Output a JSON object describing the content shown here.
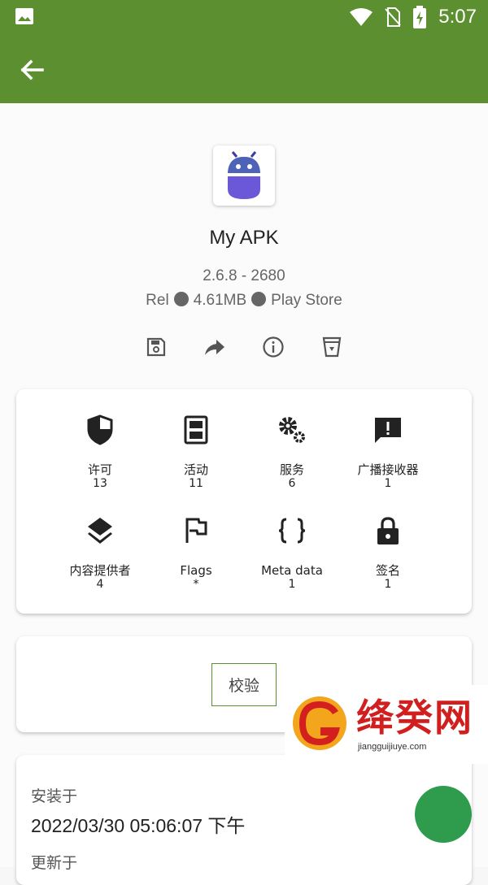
{
  "status_bar": {
    "time": "5:07",
    "icons": [
      "image-icon",
      "wifi-icon",
      "no-sim-icon",
      "battery-charging-icon"
    ]
  },
  "toolbar": {
    "back_icon": "back-arrow-icon"
  },
  "app": {
    "name": "My APK",
    "version": "2.6.8 - 2680",
    "meta": {
      "type": "Rel",
      "size": "4.61MB",
      "source": "Play Store"
    }
  },
  "actions": [
    "save-icon",
    "share-icon",
    "info-icon",
    "uninstall-icon"
  ],
  "components": [
    {
      "label": "许可",
      "count": "13",
      "icon": "shield-icon"
    },
    {
      "label": "活动",
      "count": "11",
      "icon": "activity-icon"
    },
    {
      "label": "服务",
      "count": "6",
      "icon": "gears-icon"
    },
    {
      "label": "广播接收器",
      "count": "1",
      "icon": "message-alert-icon"
    },
    {
      "label": "内容提供者",
      "count": "4",
      "icon": "layers-icon"
    },
    {
      "label": "Flags",
      "count": "*",
      "icon": "flag-icon"
    },
    {
      "label": "Meta data",
      "count": "1",
      "icon": "braces-icon"
    },
    {
      "label": "签名",
      "count": "1",
      "icon": "lock-icon"
    }
  ],
  "verify": {
    "label": "校验"
  },
  "install": {
    "installed_label": "安装于",
    "installed_value": "2022/03/30 05:06:07 下午",
    "updated_label": "更新于"
  },
  "watermark": {
    "text": "绛癸网",
    "url": "jiangguijiuye.com"
  },
  "colors": {
    "primary": "#5b8f2f",
    "fab": "#2e9b4d",
    "icon_purple": "#5a4bd1"
  }
}
